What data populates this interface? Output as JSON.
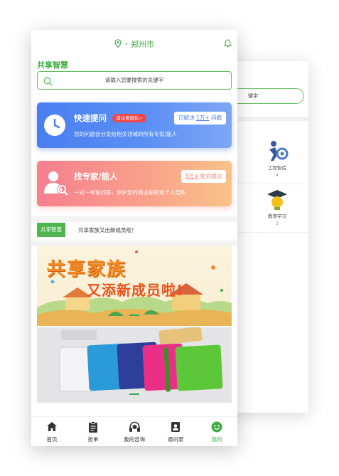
{
  "back_screen": {
    "search_text": "键字",
    "tiles": [
      {
        "name": "工程智造",
        "count": "4"
      },
      {
        "name": "教育学习",
        "count": "2"
      }
    ]
  },
  "header": {
    "city": "郑州市",
    "location_icon": "location-pin-icon",
    "bell_icon": "bell-icon"
  },
  "brand": {
    "title": "共享智慧"
  },
  "search": {
    "placeholder": "请输入您要搜索的关键字"
  },
  "quick_ask": {
    "title": "快速提问",
    "tag": "请注意隐私~",
    "desc": "您的问题会分发给相关领域的所有专家/能人",
    "stat_prefix": "已解决",
    "stat_value": "1万+",
    "stat_suffix": "问题",
    "color": "#4a7ef0"
  },
  "find_expert": {
    "title": "找专家/能人",
    "desc": "一对一单独问答，保护您的商业秘密和个人隐私",
    "stat_value": "5万+",
    "stat_suffix": "配对成功",
    "color": "#f57f8e"
  },
  "news": {
    "tag": "共享智慧",
    "text": "共享家族又出新成员啦！"
  },
  "banner1": {
    "line1": "共享家族",
    "line2": "又添新成员啦!"
  },
  "tabbar": {
    "items": [
      {
        "label": "首页",
        "icon": "home-icon"
      },
      {
        "label": "抢单",
        "icon": "clipboard-icon"
      },
      {
        "label": "我的咨询",
        "icon": "headset-icon"
      },
      {
        "label": "通讯录",
        "icon": "contacts-icon"
      },
      {
        "label": "我的",
        "icon": "smiley-icon"
      }
    ],
    "active_index": 4,
    "active_color": "#3fae3f"
  }
}
